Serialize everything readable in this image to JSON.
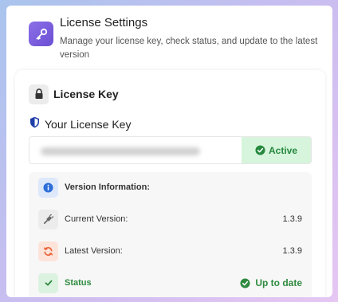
{
  "header": {
    "title": "License Settings",
    "subtitle": "Manage your license key, check status, and update to the latest version",
    "icon": "key-icon"
  },
  "license_card": {
    "title": "License Key",
    "your_key_label": "Your License Key",
    "key_value_state": "hidden",
    "status": "Active"
  },
  "version_info": {
    "title": "Version Information:",
    "current_label": "Current Version:",
    "current_value": "1.3.9",
    "latest_label": "Latest Version:",
    "latest_value": "1.3.9",
    "status_label": "Status",
    "status_value": "Up to date"
  },
  "colors": {
    "accent_purple": "#7a5ce0",
    "success_green": "#2f8a3f",
    "badge_green_bg": "#d6f5dc",
    "info_blue": "#2d6ed9",
    "update_orange": "#e8643a"
  }
}
